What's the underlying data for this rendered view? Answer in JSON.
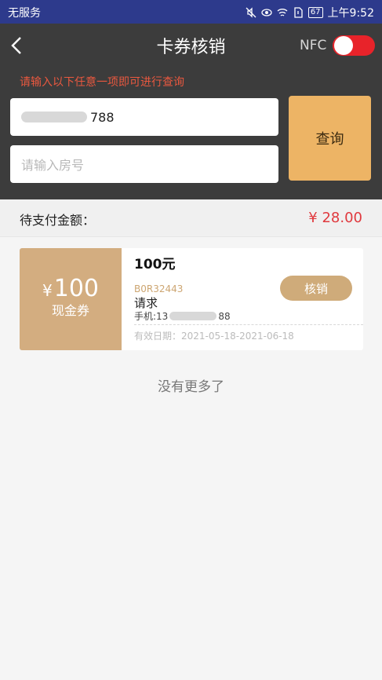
{
  "status_bar": {
    "carrier": "无服务",
    "battery": "67",
    "time": "上午9:52"
  },
  "header": {
    "title": "卡券核销",
    "nfc_label": "NFC",
    "nfc_enabled": true,
    "hint": "请输入以下任意一项即可进行查询",
    "phone_input_value": "788",
    "room_input_placeholder": "请输入房号",
    "query_button": "查询",
    "toggle_color": "#e8232a",
    "query_button_color": "#edb465"
  },
  "payment": {
    "label": "待支付金额：",
    "amount": "¥ 28.00",
    "amount_color": "#e0393e"
  },
  "coupons": [
    {
      "value_symbol": "¥",
      "value": "100",
      "type": "现金券",
      "title": "100元",
      "code": "B0R32443",
      "name": "请求",
      "phone_prefix": "手机:",
      "phone_visible_start": "13",
      "phone_visible_end": "88",
      "validity": "有效日期：2021-05-18-2021-06-18",
      "action": "核销"
    }
  ],
  "footer_text": "没有更多了",
  "icons": {
    "back": "chevron-left-icon",
    "mute": "mute-icon",
    "eye": "eye-icon",
    "wifi": "wifi-icon",
    "sim": "sim-icon",
    "battery": "battery-icon"
  }
}
